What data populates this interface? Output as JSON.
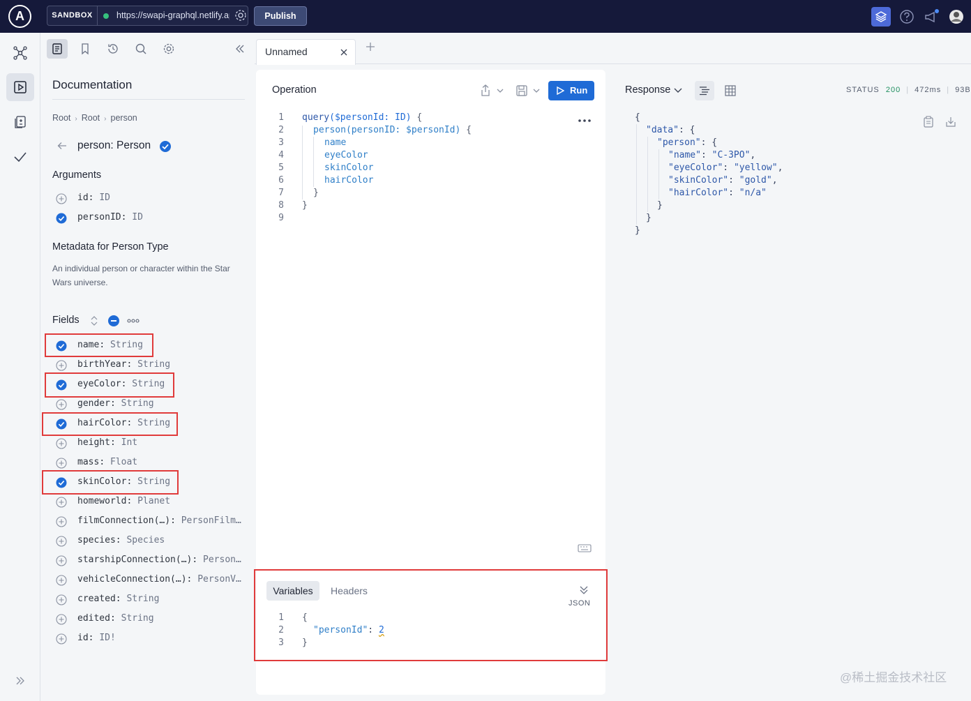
{
  "topbar": {
    "logo_letter": "A",
    "mode_label": "SANDBOX",
    "endpoint": "https://swapi-graphql.netlify.app/.netlify/functions/index",
    "publish_label": "Publish",
    "connection_status_color": "#36c07e"
  },
  "tabs": {
    "active_label": "Unnamed"
  },
  "docs": {
    "title": "Documentation",
    "breadcrumb": [
      "Root",
      "Root",
      "person"
    ],
    "type_name": "person: Person",
    "arguments_heading": "Arguments",
    "arguments": [
      {
        "name": "id",
        "type": "ID",
        "selected": false
      },
      {
        "name": "personID",
        "type": "ID",
        "selected": true
      }
    ],
    "metadata_heading": "Metadata for Person Type",
    "metadata_desc": "An individual person or character within the Star Wars universe.",
    "fields_heading": "Fields",
    "fields": [
      {
        "name": "name",
        "type": "String",
        "selected": true
      },
      {
        "name": "birthYear",
        "type": "String",
        "selected": false
      },
      {
        "name": "eyeColor",
        "type": "String",
        "selected": true
      },
      {
        "name": "gender",
        "type": "String",
        "selected": false
      },
      {
        "name": "hairColor",
        "type": "String",
        "selected": true
      },
      {
        "name": "height",
        "type": "Int",
        "selected": false
      },
      {
        "name": "mass",
        "type": "Float",
        "selected": false
      },
      {
        "name": "skinColor",
        "type": "String",
        "selected": true
      },
      {
        "name": "homeworld",
        "type": "Planet",
        "selected": false
      },
      {
        "name": "filmConnection(…)",
        "type": "PersonFilm…",
        "selected": false
      },
      {
        "name": "species",
        "type": "Species",
        "selected": false
      },
      {
        "name": "starshipConnection(…)",
        "type": "Person…",
        "selected": false
      },
      {
        "name": "vehicleConnection(…)",
        "type": "PersonV…",
        "selected": false
      },
      {
        "name": "created",
        "type": "String",
        "selected": false
      },
      {
        "name": "edited",
        "type": "String",
        "selected": false
      },
      {
        "name": "id",
        "type": "ID!",
        "selected": false
      }
    ]
  },
  "operation": {
    "title": "Operation",
    "run_label": "Run",
    "line_numbers": [
      "1",
      "2",
      "3",
      "4",
      "5",
      "6",
      "7",
      "8",
      "9"
    ],
    "code": {
      "l1_kw": "query",
      "l1_var": "($personId: ID)",
      "l1_end": " {",
      "l2_field": "person",
      "l2_args": "(personID: $personId)",
      "l2_end": " {",
      "l3": "name",
      "l4": "eyeColor",
      "l5": "skinColor",
      "l6": "hairColor",
      "l7": "}",
      "l8": "}"
    }
  },
  "variables": {
    "active_tab": "Variables",
    "other_tab": "Headers",
    "format_label": "JSON",
    "line_numbers": [
      "1",
      "2",
      "3"
    ],
    "open": "{",
    "key": "\"personId\"",
    "value": "2",
    "close": "}"
  },
  "response": {
    "title": "Response",
    "status_label": "STATUS",
    "status_code": "200",
    "time": "472ms",
    "size": "93B",
    "lines": {
      "open": "{",
      "data_key": "\"data\"",
      "person_key": "\"person\"",
      "name_key": "\"name\"",
      "name_val": "\"C-3PO\"",
      "eye_key": "\"eyeColor\"",
      "eye_val": "\"yellow\"",
      "skin_key": "\"skinColor\"",
      "skin_val": "\"gold\"",
      "hair_key": "\"hairColor\"",
      "hair_val": "\"n/a\"",
      "close_person": "}",
      "close_data": "}",
      "close": "}"
    }
  },
  "watermark": "@稀土掘金技术社区",
  "colors": {
    "topbar": "#15193a",
    "accent": "#1f6bd6",
    "highlight_border": "#e03b3b"
  }
}
